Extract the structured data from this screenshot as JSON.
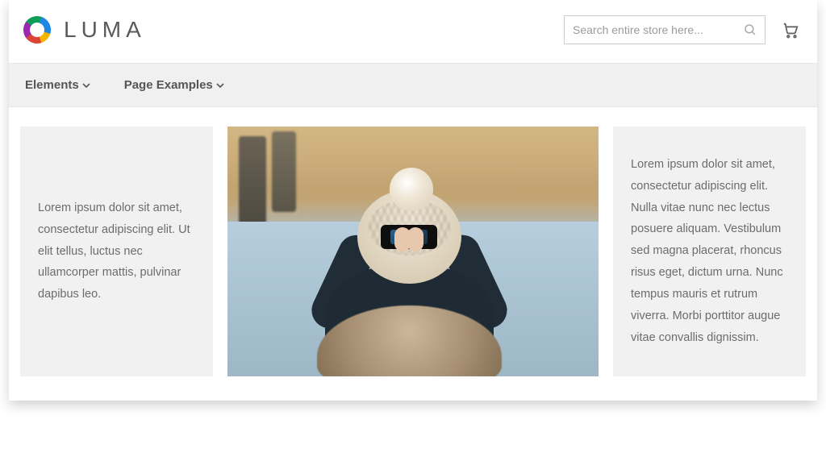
{
  "brand": {
    "name": "LUMA"
  },
  "search": {
    "placeholder": "Search entire store here..."
  },
  "nav": {
    "items": [
      {
        "label": "Elements"
      },
      {
        "label": "Page Examples"
      }
    ]
  },
  "columns": {
    "left": "Lorem ipsum dolor sit amet, consectetur adipiscing elit. Ut elit tellus, luctus nec ullamcorper mattis, pulvinar dapibus leo.",
    "right": "Lorem ipsum dolor sit amet, consectetur adipiscing elit. Nulla vitae nunc nec lectus posuere aliquam. Vestibulum sed magna placerat, rhoncus risus eget, dictum urna. Nunc tempus mauris et rutrum viverra. Morbi porttitor augue vitae convallis dignissim."
  }
}
